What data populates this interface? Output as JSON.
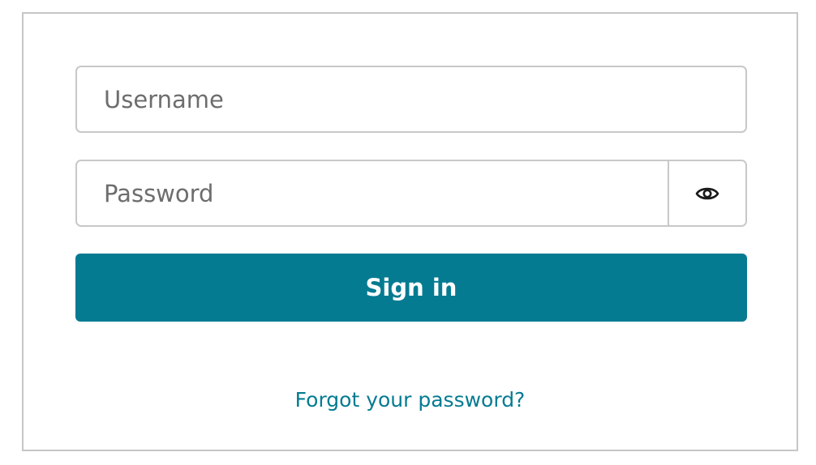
{
  "colors": {
    "accent": "#057B92",
    "border": "#C8C8C8",
    "placeholder": "#6D6D6D",
    "icon": "#1A1A1A"
  },
  "form": {
    "username": {
      "placeholder": "Username",
      "value": ""
    },
    "password": {
      "placeholder": "Password",
      "value": "",
      "toggle_icon": "eye-icon"
    },
    "sign_in_label": "Sign in",
    "forgot_password_label": "Forgot your password?"
  }
}
